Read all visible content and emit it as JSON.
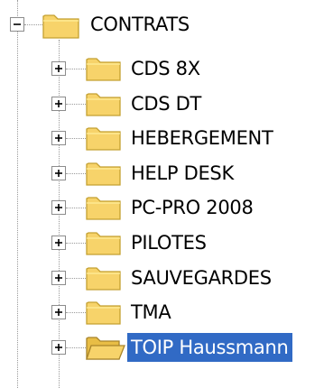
{
  "tree": {
    "root": {
      "label": "CONTRATS",
      "expanded": true,
      "icon": "folder-icon"
    },
    "children": [
      {
        "label": "CDS 8X",
        "expanded": false,
        "selected": false,
        "icon": "folder-icon"
      },
      {
        "label": "CDS DT",
        "expanded": false,
        "selected": false,
        "icon": "folder-icon"
      },
      {
        "label": "HEBERGEMENT",
        "expanded": false,
        "selected": false,
        "icon": "folder-icon"
      },
      {
        "label": "HELP DESK",
        "expanded": false,
        "selected": false,
        "icon": "folder-icon"
      },
      {
        "label": "PC-PRO 2008",
        "expanded": false,
        "selected": false,
        "icon": "folder-icon"
      },
      {
        "label": "PILOTES",
        "expanded": false,
        "selected": false,
        "icon": "folder-icon"
      },
      {
        "label": "SAUVEGARDES",
        "expanded": false,
        "selected": false,
        "icon": "folder-icon"
      },
      {
        "label": "TMA",
        "expanded": false,
        "selected": false,
        "icon": "folder-icon"
      },
      {
        "label": "TOIP Haussmann",
        "expanded": false,
        "selected": true,
        "icon": "folder-open-icon"
      }
    ]
  },
  "colors": {
    "selection_bg": "#316ac5",
    "selection_text": "#ffffff",
    "folder_fill": "#f7d36a",
    "folder_outline": "#c4a030"
  }
}
